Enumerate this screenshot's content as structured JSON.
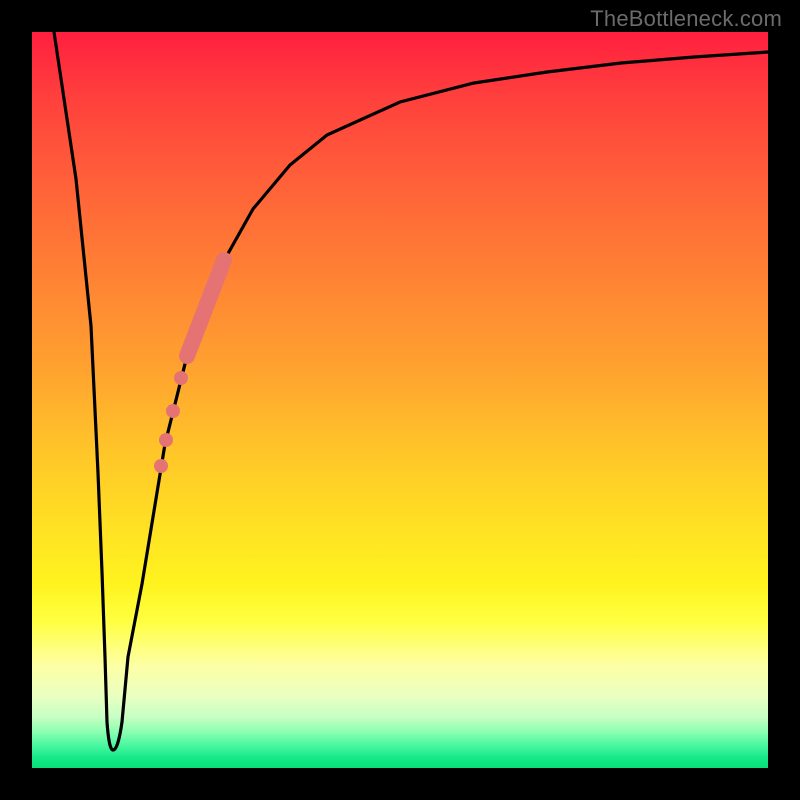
{
  "watermark": "TheBottleneck.com",
  "colors": {
    "background_frame": "#000000",
    "gradient_top": "#ff1f3f",
    "gradient_mid1": "#ffa030",
    "gradient_mid2": "#ffe323",
    "gradient_bottom": "#07df7a",
    "curve_stroke": "#000000",
    "marker_fill": "#e57373",
    "watermark_text": "#6b6b6b"
  },
  "chart_data": {
    "type": "line",
    "title": "",
    "xlabel": "",
    "ylabel": "",
    "xlim": [
      0,
      100
    ],
    "ylim": [
      0,
      100
    ],
    "grid": false,
    "legend": false,
    "curve": {
      "x": [
        3,
        5,
        7,
        9,
        10,
        11,
        12,
        13,
        15,
        18,
        21,
        25,
        30,
        35,
        40,
        50,
        60,
        70,
        80,
        90,
        100
      ],
      "y": [
        100,
        70,
        40,
        10,
        3,
        2,
        3,
        10,
        25,
        44,
        56,
        67,
        76,
        82,
        86,
        90.5,
        93,
        94.6,
        95.8,
        96.6,
        97.2
      ]
    },
    "series": [
      {
        "name": "highlighted-band",
        "type": "line-thick",
        "x": [
          21.0,
          26.0
        ],
        "y": [
          56.0,
          69.0
        ]
      },
      {
        "name": "marker-dots",
        "type": "scatter",
        "x": [
          17.5,
          18.2,
          19.2,
          20.3
        ],
        "y": [
          41.0,
          44.5,
          48.5,
          53.0
        ]
      }
    ]
  }
}
